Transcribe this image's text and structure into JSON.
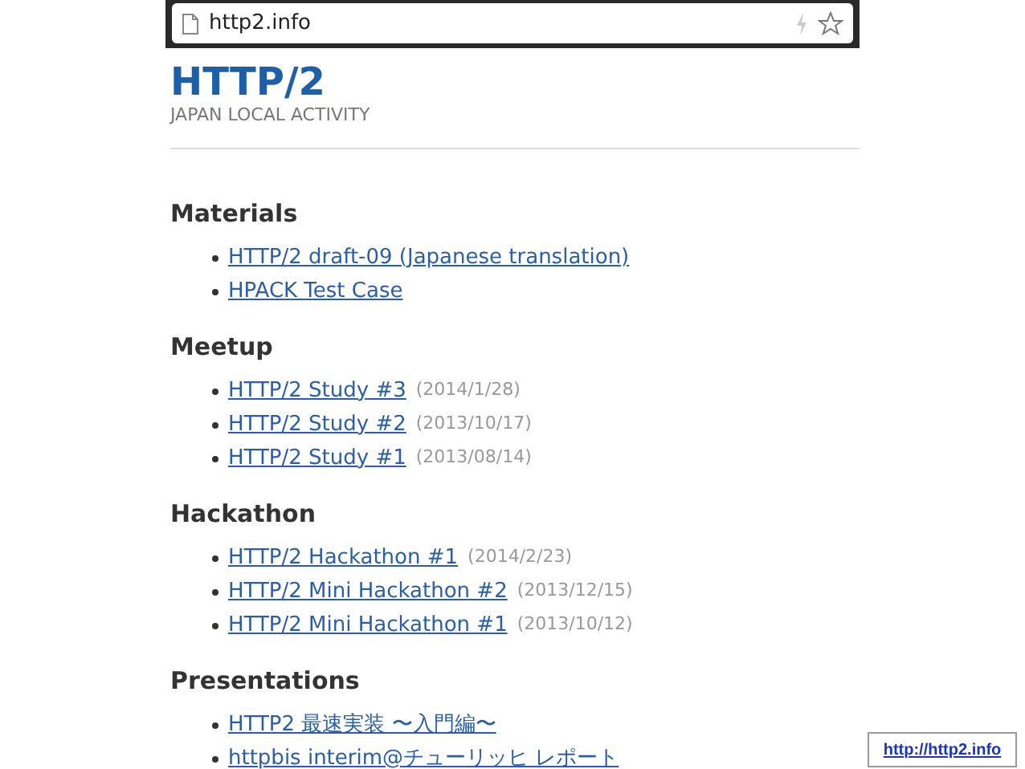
{
  "address_bar": {
    "url": "http2.info"
  },
  "header": {
    "title": "HTTP/2",
    "subtitle": "JAPAN LOCAL ACTIVITY"
  },
  "sections": [
    {
      "heading": "Materials",
      "items": [
        {
          "link": "HTTP/2 draft-09 (Japanese translation)"
        },
        {
          "link": "HPACK Test Case"
        }
      ]
    },
    {
      "heading": "Meetup",
      "items": [
        {
          "link": "HTTP/2 Study #3",
          "date": "(2014/1/28)"
        },
        {
          "link": "HTTP/2 Study #2",
          "date": "(2013/10/17)"
        },
        {
          "link": "HTTP/2 Study #1",
          "date": "(2013/08/14)"
        }
      ]
    },
    {
      "heading": "Hackathon",
      "items": [
        {
          "link": "HTTP/2 Hackathon #1",
          "date": "(2014/2/23)"
        },
        {
          "link": "HTTP/2 Mini Hackathon #2",
          "date": "(2013/12/15)"
        },
        {
          "link": "HTTP/2 Mini Hackathon #1",
          "date": "(2013/10/12)"
        }
      ]
    },
    {
      "heading": "Presentations",
      "items": [
        {
          "link": "HTTP2 最速実装 〜入門編〜"
        },
        {
          "link": "httpbis interim@チューリッヒ レポート"
        }
      ]
    }
  ],
  "footer_link": "http://http2.info"
}
